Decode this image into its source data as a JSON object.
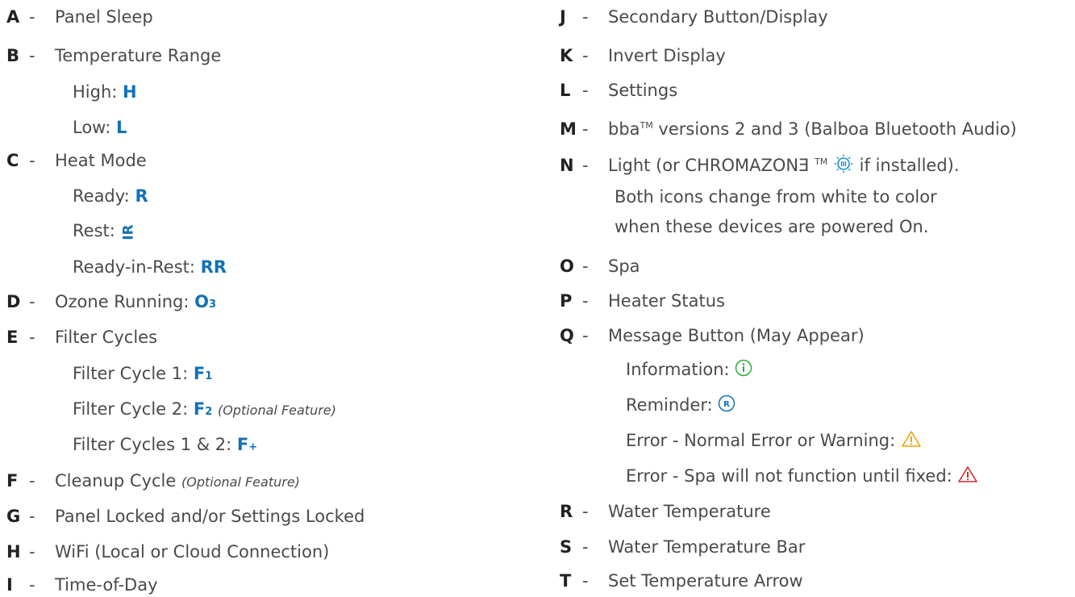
{
  "left": {
    "A": {
      "letter": "A",
      "dash": "-",
      "label": "Panel Sleep"
    },
    "B": {
      "letter": "B",
      "dash": "-",
      "label": "Temperature Range",
      "high_label": "High:",
      "high_code": "H",
      "low_label": "Low:",
      "low_code": "L"
    },
    "C": {
      "letter": "C",
      "dash": "-",
      "label": "Heat Mode",
      "ready_label": "Ready:",
      "ready_code": "R",
      "rest_label": "Rest:",
      "rest_code": "IR",
      "rir_label": "Ready-in-Rest:",
      "rir_code": "RR"
    },
    "D": {
      "letter": "D",
      "dash": "-",
      "label": "Ozone Running:",
      "code_main": "O",
      "code_sub": "3"
    },
    "E": {
      "letter": "E",
      "dash": "-",
      "label": "Filter Cycles",
      "fc1_label": "Filter Cycle 1:",
      "fc1_code": "F",
      "fc1_sub": "1",
      "fc2_label": "Filter Cycle 2:",
      "fc2_code": "F",
      "fc2_sub": "2",
      "fc2_note": "(Optional Feature)",
      "fc12_label": "Filter Cycles 1 & 2:",
      "fc12_code": "F",
      "fc12_sub": "+"
    },
    "F": {
      "letter": "F",
      "dash": "-",
      "label": "Cleanup Cycle",
      "note": "(Optional Feature)"
    },
    "G": {
      "letter": "G",
      "dash": "-",
      "label": "Panel Locked and/or Settings Locked"
    },
    "H": {
      "letter": "H",
      "dash": "-",
      "label": "WiFi (Local or Cloud Connection)"
    },
    "I": {
      "letter": "I",
      "dash": "-",
      "label": "Time-of-Day"
    }
  },
  "right": {
    "J": {
      "letter": "J",
      "dash": "-",
      "label": "Secondary Button/Display"
    },
    "K": {
      "letter": "K",
      "dash": "-",
      "label": "Invert Display"
    },
    "L": {
      "letter": "L",
      "dash": "-",
      "label": "Settings"
    },
    "M": {
      "letter": "M",
      "dash": "-",
      "label_a": "bba",
      "tm": "TM",
      "label_b": " versions 2 and 3 (Balboa Bluetooth Audio)"
    },
    "N": {
      "letter": "N",
      "dash": "-",
      "label_a": "Light (or CHROMAZONƎ",
      "tm": "TM",
      "label_b": " if installed).",
      "note1": "Both icons change from white to color",
      "note2": "when these devices are powered On."
    },
    "O": {
      "letter": "O",
      "dash": "-",
      "label": "Spa"
    },
    "P": {
      "letter": "P",
      "dash": "-",
      "label": "Heater Status"
    },
    "Q": {
      "letter": "Q",
      "dash": "-",
      "label": "Message Button (May Appear)",
      "info_label": "Information:",
      "rem_label": "Reminder:",
      "err1_label": "Error - Normal Error or Warning:",
      "err2_label": "Error - Spa will not function until fixed:"
    },
    "R": {
      "letter": "R",
      "dash": "-",
      "label": "Water Temperature"
    },
    "S": {
      "letter": "S",
      "dash": "-",
      "label": "Water Temperature Bar"
    },
    "T": {
      "letter": "T",
      "dash": "-",
      "label": "Set Temperature Arrow"
    }
  },
  "icons": {
    "info_icon": "info-circle-icon",
    "reminder_icon": "reminder-circle-icon",
    "warning_icon": "warning-triangle-icon",
    "error_icon": "error-triangle-icon",
    "chromazone_icon": "chromazone-icon"
  },
  "colors": {
    "code_blue": "#1271b8",
    "info_green": "#2eab3a",
    "reminder_blue": "#1271b8",
    "warning_orange": "#f0a30a",
    "error_red": "#d8262a",
    "chromazone_blue": "#1a8fd0"
  }
}
